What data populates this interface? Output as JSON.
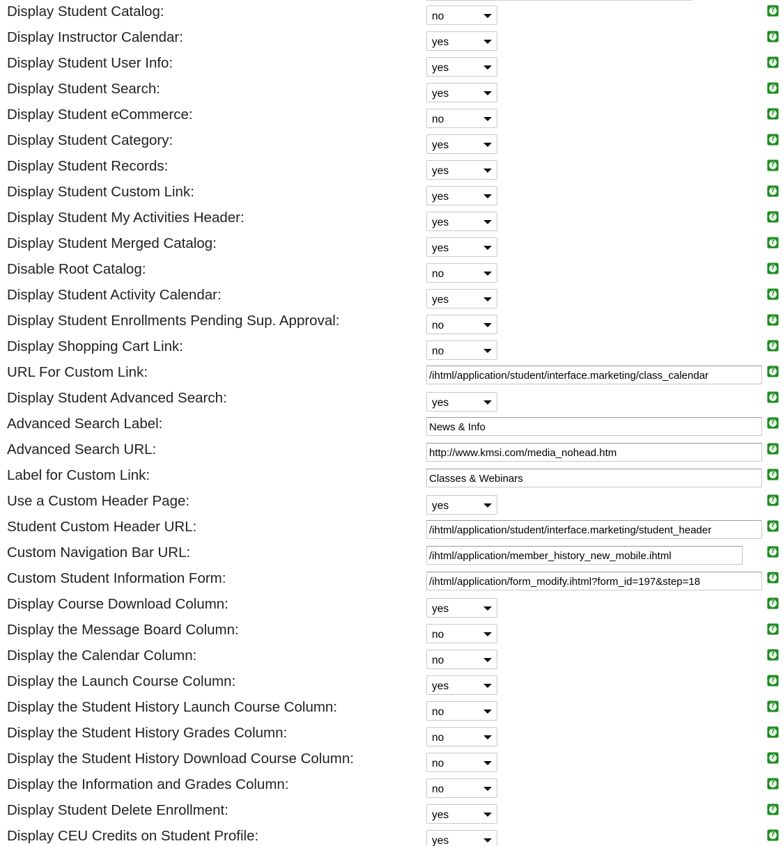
{
  "rows": [
    {
      "label": "Display Student Catalog:",
      "value": "no",
      "kind": "select"
    },
    {
      "label": "Display Instructor Calendar:",
      "value": "yes",
      "kind": "select"
    },
    {
      "label": "Display Student User Info:",
      "value": "yes",
      "kind": "select"
    },
    {
      "label": "Display Student Search:",
      "value": "yes",
      "kind": "select"
    },
    {
      "label": "Display Student eCommerce:",
      "value": "no",
      "kind": "select"
    },
    {
      "label": "Display Student Category:",
      "value": "yes",
      "kind": "select"
    },
    {
      "label": "Display Student Records:",
      "value": "yes",
      "kind": "select"
    },
    {
      "label": "Display Student Custom Link:",
      "value": "yes",
      "kind": "select"
    },
    {
      "label": "Display Student My Activities Header:",
      "value": "yes",
      "kind": "select"
    },
    {
      "label": "Display Student Merged Catalog:",
      "value": "yes",
      "kind": "select"
    },
    {
      "label": "Disable Root Catalog:",
      "value": "no",
      "kind": "select"
    },
    {
      "label": "Display Student Activity Calendar:",
      "value": "yes",
      "kind": "select"
    },
    {
      "label": "Display Student Enrollments Pending Sup. Approval:",
      "value": "no",
      "kind": "select"
    },
    {
      "label": "Display Shopping Cart Link:",
      "value": "no",
      "kind": "select"
    },
    {
      "label": "URL For Custom Link:",
      "value": "/ihtml/application/student/interface.marketing/class_calendar",
      "kind": "text"
    },
    {
      "label": "Display Student Advanced Search:",
      "value": "yes",
      "kind": "select"
    },
    {
      "label": "Advanced Search Label:",
      "value": "News & Info",
      "kind": "text"
    },
    {
      "label": "Advanced Search URL:",
      "value": "http://www.kmsi.com/media_nohead.htm",
      "kind": "text"
    },
    {
      "label": "Label for Custom Link:",
      "value": "Classes & Webinars",
      "kind": "text"
    },
    {
      "label": "Use a Custom Header Page:",
      "value": "yes",
      "kind": "select"
    },
    {
      "label": "Student Custom Header URL:",
      "value": "/ihtml/application/student/interface.marketing/student_header",
      "kind": "text"
    },
    {
      "label": "Custom Navigation Bar URL:",
      "value": "/ihtml/application/member_history_new_mobile.ihtml",
      "kind": "text"
    },
    {
      "label": "Custom Student Information Form:",
      "value": "/ihtml/application/form_modify.ihtml?form_id=197&step=18",
      "kind": "text"
    },
    {
      "label": "Display Course Download Column:",
      "value": "yes",
      "kind": "select"
    },
    {
      "label": "Display the Message Board Column:",
      "value": "no",
      "kind": "select"
    },
    {
      "label": "Display the Calendar Column:",
      "value": "no",
      "kind": "select"
    },
    {
      "label": "Display the Launch Course Column:",
      "value": "yes",
      "kind": "select"
    },
    {
      "label": "Display the Student History Launch Course Column:",
      "value": "no",
      "kind": "select"
    },
    {
      "label": "Display the Student History Grades Column:",
      "value": "no",
      "kind": "select"
    },
    {
      "label": "Display the Student History Download Course Column:",
      "value": "no",
      "kind": "select"
    },
    {
      "label": "Display the Information and Grades Column:",
      "value": "no",
      "kind": "select"
    },
    {
      "label": "Display Student Delete Enrollment:",
      "value": "yes",
      "kind": "select"
    },
    {
      "label": "Display CEU Credits on Student Profile:",
      "value": "yes",
      "kind": "select"
    }
  ],
  "help_icon": "help-question-icon",
  "colors": {
    "help_green": "#1f8a22",
    "border": "#c8c8c8",
    "label_text": "#222222"
  }
}
